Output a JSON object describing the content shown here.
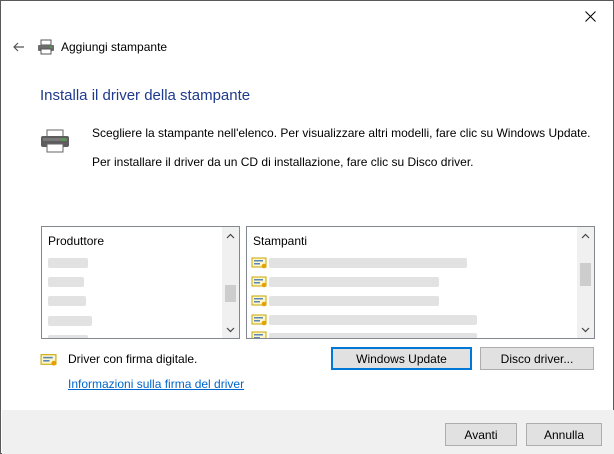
{
  "window": {
    "title": "Aggiungi stampante"
  },
  "heading": "Installa il driver della stampante",
  "instructions": {
    "line1": "Scegliere la stampante nell'elenco. Per visualizzare altri modelli, fare clic su Windows Update.",
    "line2": "Per installare il driver da un CD di installazione, fare clic su Disco driver."
  },
  "manufacturers": {
    "header": "Produttore"
  },
  "printers": {
    "header": "Stampanti"
  },
  "signature": {
    "label": "Driver con firma digitale.",
    "link": "Informazioni sulla firma del driver"
  },
  "buttons": {
    "windows_update": "Windows Update",
    "disk_driver": "Disco driver...",
    "next": "Avanti",
    "cancel": "Annulla"
  },
  "icons": {
    "close": "close-icon",
    "back": "back-arrow-icon",
    "printer": "printer-icon",
    "certified_driver": "certified-driver-icon"
  },
  "colors": {
    "heading": "#1e3a8c",
    "link": "#0066cc",
    "focus_border": "#0078d7"
  }
}
